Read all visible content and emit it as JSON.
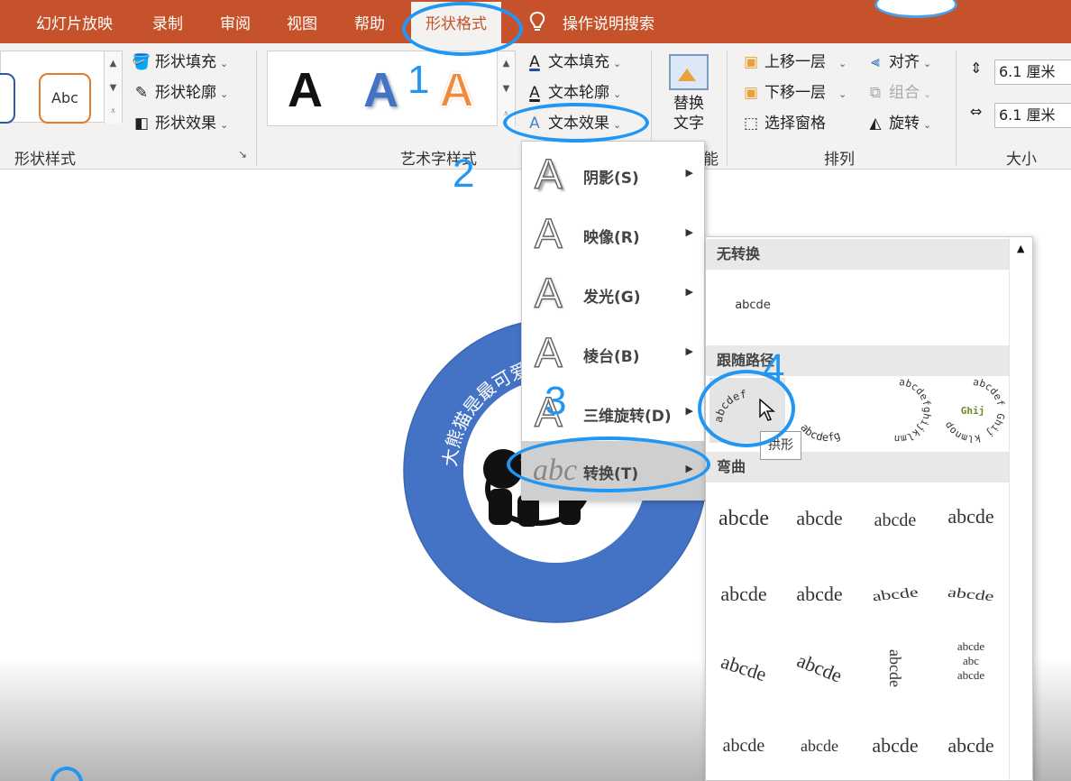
{
  "tabs": [
    {
      "label": "幻灯片放映"
    },
    {
      "label": "录制"
    },
    {
      "label": "审阅"
    },
    {
      "label": "视图"
    },
    {
      "label": "帮助"
    },
    {
      "label": "形状格式",
      "active": true
    }
  ],
  "tell_me": {
    "label": "操作说明搜索",
    "icon": "lightbulb-icon"
  },
  "ribbon": {
    "shape_styles": {
      "label": "形状样式",
      "swatch_text": "Abc",
      "fill": "形状填充",
      "outline": "形状轮廓",
      "effects": "形状效果"
    },
    "wordart_styles": {
      "label": "艺术字样式",
      "samples": [
        "A",
        "A",
        "A"
      ],
      "text_fill": "文本填充",
      "text_outline": "文本轮廓",
      "text_effects": "文本效果"
    },
    "accessibility": {
      "alt_text_line1": "替换",
      "alt_text_line2": "文字",
      "label_tail": "能"
    },
    "arrange": {
      "label": "排列",
      "bring_forward": "上移一层",
      "send_backward": "下移一层",
      "selection_pane": "选择窗格",
      "align": "对齐",
      "group": "组合",
      "rotate": "旋转"
    },
    "size": {
      "label": "大小",
      "height": "6.1 厘米",
      "width": "6.1 厘米"
    }
  },
  "slide": {
    "ring_text": "大熊猫是最可爱"
  },
  "text_effects_menu": [
    {
      "label": "阴影(S)",
      "icon": "shadow-A-icon"
    },
    {
      "label": "映像(R)",
      "icon": "reflection-A-icon"
    },
    {
      "label": "发光(G)",
      "icon": "glow-A-icon"
    },
    {
      "label": "棱台(B)",
      "icon": "bevel-A-icon"
    },
    {
      "label": "三维旋转(D)",
      "icon": "3d-rotation-A-icon"
    },
    {
      "label": "转换(T)",
      "icon": "transform-abc-icon",
      "selected": true
    }
  ],
  "transform_panel": {
    "no_transform": {
      "header": "无转换",
      "sample": "abcde"
    },
    "follow_path": {
      "header": "跟随路径",
      "samples": [
        "abcdef",
        "abcdefg",
        "abcdefghijklmn",
        "abcdef Ghij klmnop"
      ]
    },
    "warp": {
      "header": "弯曲",
      "rows": [
        [
          "abcde",
          "abcde",
          "abcde",
          "abcde"
        ],
        [
          "abcde",
          "abcde",
          "abcde",
          "abcde"
        ],
        [
          "abcde",
          "abcde",
          "abcde",
          "abcde"
        ],
        [
          "abcde",
          "abcde",
          "abcde",
          "abcde"
        ]
      ],
      "stacked_sample": [
        "abcde",
        "abc",
        "abcde"
      ]
    },
    "tooltip": "拱形"
  },
  "annotations": [
    "1",
    "2",
    "3",
    "4"
  ],
  "colors": {
    "tab_bar": "#c5522a",
    "ribbon_bg": "#f3f2f1",
    "ring_blue": "#4472c4",
    "annotation_blue": "#2196f3",
    "menu_selected": "#cfcfcf"
  }
}
